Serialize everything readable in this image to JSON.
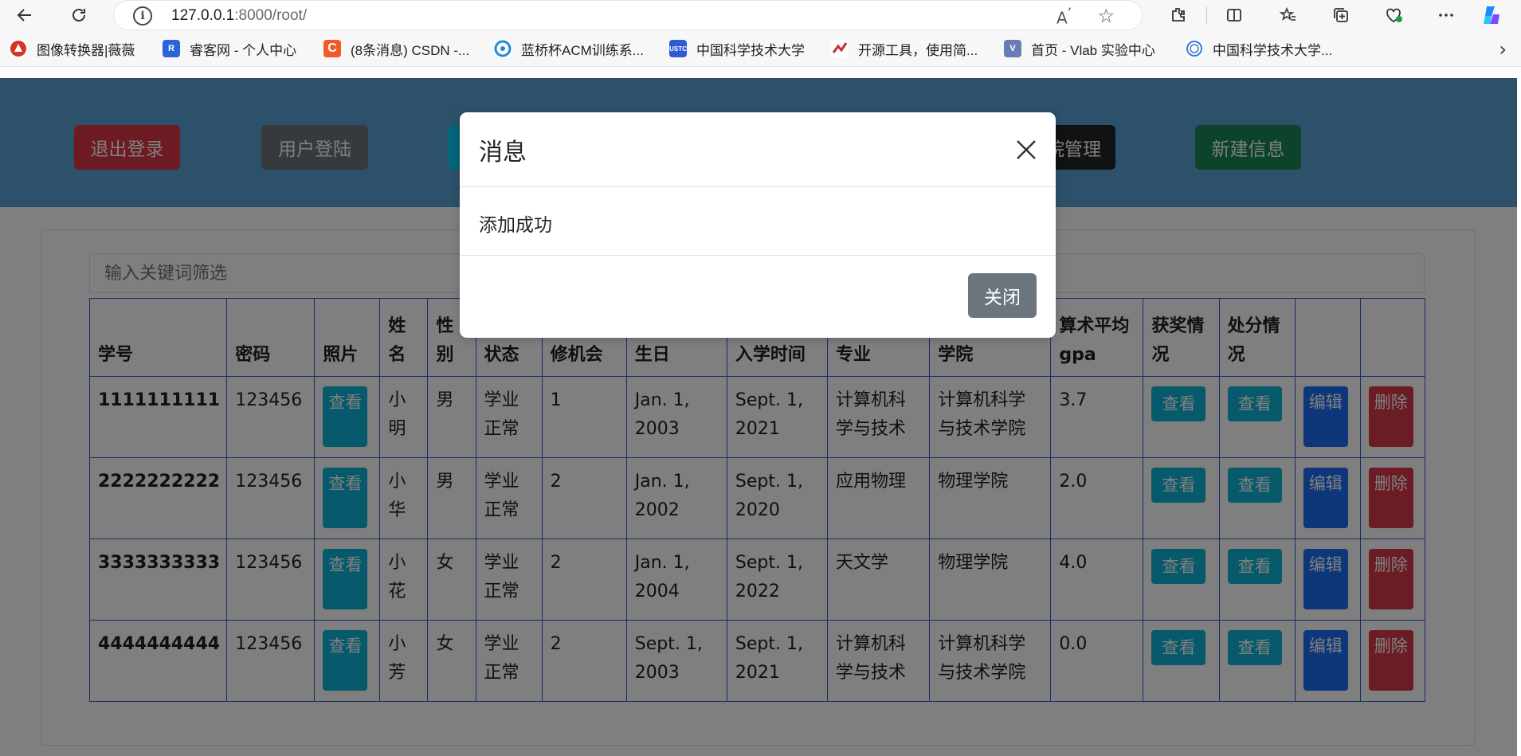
{
  "browser": {
    "url_host": "127.0.0.1",
    "url_rest": ":8000/root/",
    "bookmarks": [
      {
        "label": "图像转换器|薇薇",
        "icon": "warning-triangle-icon",
        "color": "#d6322b"
      },
      {
        "label": "睿客网 - 个人中心",
        "icon": "ruike-icon",
        "color": "#2d63d6"
      },
      {
        "label": "(8条消息) CSDN -...",
        "icon": "csdn-icon",
        "color": "#f05a28"
      },
      {
        "label": "蓝桥杯ACM训练系...",
        "icon": "lanqiao-icon",
        "color": "#1e8bd6"
      },
      {
        "label": "中国科学技术大学",
        "icon": "ustc-icon",
        "color": "#2e5bd1"
      },
      {
        "label": "开源工具，使用简...",
        "icon": "open-tool-icon",
        "color": "#c62f2f"
      },
      {
        "label": "首页 - Vlab 实验中心",
        "icon": "vlab-icon",
        "color": "#6b7bb8"
      },
      {
        "label": "中国科学技术大学...",
        "icon": "ustc-seal-icon",
        "color": "#3a7bd5"
      }
    ]
  },
  "nav": {
    "logout": "退出登录",
    "user_login": "用户登陆",
    "college_mgmt": "院管理",
    "new_info": "新建信息"
  },
  "filter": {
    "placeholder": "输入关键词筛选"
  },
  "table": {
    "headers": [
      "学号",
      "密码",
      "照片",
      "姓名",
      "性别",
      "状态",
      "修机会",
      "生日",
      "入学时间",
      "专业",
      "学院",
      "算术平均gpa",
      "获奖情况",
      "处分情况",
      "",
      ""
    ],
    "view_label": "查看",
    "view_label_v": "查看",
    "edit_label": "编辑",
    "delete_label": "删除",
    "rows": [
      {
        "id": "1111111111",
        "pwd": "123456",
        "name": "小明",
        "gender": "男",
        "status": "学业正常",
        "chance": "1",
        "birthday": "Jan. 1, 2003",
        "enroll": "Sept. 1, 2021",
        "major": "计算机科学与技术",
        "college": "计算机科学与技术学院",
        "gpa": "3.7"
      },
      {
        "id": "2222222222",
        "pwd": "123456",
        "name": "小华",
        "gender": "男",
        "status": "学业正常",
        "chance": "2",
        "birthday": "Jan. 1, 2002",
        "enroll": "Sept. 1, 2020",
        "major": "应用物理",
        "college": "物理学院",
        "gpa": "2.0"
      },
      {
        "id": "3333333333",
        "pwd": "123456",
        "name": "小花",
        "gender": "女",
        "status": "学业正常",
        "chance": "2",
        "birthday": "Jan. 1, 2004",
        "enroll": "Sept. 1, 2022",
        "major": "天文学",
        "college": "物理学院",
        "gpa": "4.0"
      },
      {
        "id": "4444444444",
        "pwd": "123456",
        "name": "小芳",
        "gender": "女",
        "status": "学业正常",
        "chance": "2",
        "birthday": "Sept. 1, 2003",
        "enroll": "Sept. 1, 2021",
        "major": "计算机科学与技术",
        "college": "计算机科学与技术学院",
        "gpa": "0.0"
      }
    ]
  },
  "modal": {
    "title": "消息",
    "message": "添加成功",
    "close_button": "关闭"
  },
  "colors": {
    "navbar": "#5aa3d6",
    "logout": "#dc3545",
    "user_login": "#6c757d",
    "college_mgmt": "#212529",
    "new_info": "#198754",
    "info": "#0fb5d6",
    "primary": "#1a6ef5",
    "danger": "#d9394a"
  }
}
